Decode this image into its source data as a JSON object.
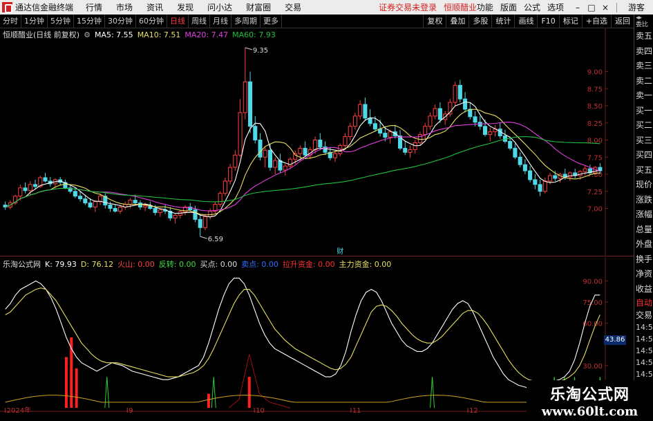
{
  "menubar": {
    "app_title": "通达信金融终端",
    "items": [
      "行情",
      "市场",
      "资讯",
      "发现",
      "问小达",
      "财富圈",
      "交易"
    ],
    "notice": "证券交易未登录",
    "stock_name": "恒顺醋业",
    "right_items": [
      "功能",
      "版面",
      "公式",
      "选项"
    ],
    "guest": "游客"
  },
  "toolbar": {
    "periods": [
      "分时",
      "1分钟",
      "5分钟",
      "15分钟",
      "30分钟",
      "60分钟",
      "日线",
      "周线",
      "月线",
      "多周期",
      "更多"
    ],
    "active_period": "日线",
    "right_buttons": [
      "复权",
      "叠加",
      "多股",
      "统计",
      "画线",
      "F10",
      "标记",
      "+自选",
      "返回"
    ]
  },
  "main_title": {
    "stock": "恒顺醋业(日线 前复权)",
    "ma5": "MA5: 7.55",
    "ma10": "MA10: 7.51",
    "ma20": "MA20: 7.47",
    "ma60": "MA60: 7.93"
  },
  "indicator_title": {
    "name": "乐淘公式网",
    "k": "K: 79.93",
    "d": "D: 76.12",
    "huoshan": "火山: 0.00",
    "fanzhuan": "反转: 0.00",
    "maidian": "买点: 0.00",
    "maichu": "卖点: 0.00",
    "lasheng": "拉升资金: 0.00",
    "zhuli": "主力资金: 0.00"
  },
  "price_axis": [
    "9.00",
    "8.75",
    "8.50",
    "8.25",
    "8.00",
    "7.75",
    "7.50",
    "7.25",
    "7.00"
  ],
  "ind_axis": [
    "90.00",
    "75.00",
    "60.00",
    "30.00",
    "15.00"
  ],
  "ind_current_value": "43.86",
  "annotations": {
    "high": "9.35",
    "low": "6.59",
    "cai": "财"
  },
  "x_axis": [
    "2024年",
    "9",
    "10",
    "11",
    "12",
    "1"
  ],
  "quote_panel": {
    "header": "委比",
    "labels": [
      "卖五",
      "卖四",
      "卖三",
      "卖二",
      "卖一",
      "买一",
      "买二",
      "买三",
      "买四",
      "买五",
      "现价",
      "涨跌",
      "涨幅",
      "总量",
      "外盘",
      "换手",
      "净资",
      "收益"
    ],
    "tab_auto": "自动",
    "tab_trade": "交易",
    "times": [
      "14:56",
      "14:56",
      "14:56",
      "14:56",
      "14:56",
      "14:56",
      "14:56",
      "14:56",
      "14:56"
    ]
  },
  "watermark": {
    "title": "乐淘公式网",
    "url": "www.60lt.com"
  },
  "colors": {
    "up": "#ff4040",
    "down": "#4ed8e8",
    "ma5": "#ffffff",
    "ma10": "#e8e060",
    "ma20": "#e040e0",
    "ma60": "#20c040",
    "k_line": "#ffffff",
    "d_line": "#e8e060"
  },
  "chart_data": [
    {
      "type": "candlestick",
      "title": "恒顺醋业(日线 前复权)",
      "ylim": [
        6.5,
        9.45
      ],
      "x_labels": [
        "2024年",
        "9",
        "10",
        "11",
        "12",
        "1"
      ],
      "x_label_index": [
        0,
        24,
        49,
        68,
        91,
        114
      ],
      "ohlc": [
        [
          7.05,
          7.1,
          6.98,
          7.02
        ],
        [
          7.02,
          7.12,
          6.99,
          7.08
        ],
        [
          7.08,
          7.2,
          7.05,
          7.18
        ],
        [
          7.18,
          7.35,
          7.12,
          7.3
        ],
        [
          7.3,
          7.38,
          7.22,
          7.26
        ],
        [
          7.26,
          7.4,
          7.2,
          7.35
        ],
        [
          7.35,
          7.42,
          7.28,
          7.32
        ],
        [
          7.32,
          7.48,
          7.3,
          7.45
        ],
        [
          7.45,
          7.52,
          7.38,
          7.4
        ],
        [
          7.4,
          7.46,
          7.32,
          7.36
        ],
        [
          7.36,
          7.44,
          7.3,
          7.42
        ],
        [
          7.42,
          7.46,
          7.34,
          7.38
        ],
        [
          7.38,
          7.42,
          7.28,
          7.3
        ],
        [
          7.3,
          7.35,
          7.22,
          7.25
        ],
        [
          7.25,
          7.3,
          7.15,
          7.18
        ],
        [
          7.18,
          7.25,
          7.1,
          7.14
        ],
        [
          7.14,
          7.2,
          7.05,
          7.08
        ],
        [
          7.08,
          7.15,
          7.0,
          7.02
        ],
        [
          7.02,
          7.12,
          6.95,
          7.1
        ],
        [
          7.1,
          7.22,
          7.05,
          7.18
        ],
        [
          7.18,
          7.22,
          7.0,
          7.05
        ],
        [
          7.05,
          7.1,
          6.95,
          7.0
        ],
        [
          7.0,
          7.06,
          6.94,
          6.96
        ],
        [
          6.96,
          7.05,
          6.92,
          7.02
        ],
        [
          7.02,
          7.1,
          6.98,
          7.06
        ],
        [
          7.06,
          7.15,
          7.0,
          7.12
        ],
        [
          7.12,
          7.2,
          7.06,
          7.08
        ],
        [
          7.08,
          7.12,
          6.98,
          7.02
        ],
        [
          7.02,
          7.08,
          6.96,
          7.04
        ],
        [
          7.04,
          7.1,
          6.98,
          7.0
        ],
        [
          7.0,
          7.05,
          6.9,
          6.94
        ],
        [
          6.94,
          7.0,
          6.88,
          6.98
        ],
        [
          6.98,
          7.05,
          6.92,
          6.96
        ],
        [
          6.96,
          7.02,
          6.82,
          6.86
        ],
        [
          6.86,
          6.92,
          6.78,
          6.9
        ],
        [
          6.9,
          6.98,
          6.85,
          6.95
        ],
        [
          6.95,
          7.05,
          6.9,
          7.02
        ],
        [
          7.02,
          7.08,
          6.96,
          6.98
        ],
        [
          6.98,
          7.04,
          6.8,
          6.84
        ],
        [
          6.84,
          6.9,
          6.59,
          6.72
        ],
        [
          6.72,
          6.92,
          6.68,
          6.88
        ],
        [
          6.88,
          7.0,
          6.84,
          6.96
        ],
        [
          6.96,
          7.1,
          6.92,
          7.06
        ],
        [
          7.06,
          7.25,
          7.02,
          7.22
        ],
        [
          7.22,
          7.45,
          7.18,
          7.4
        ],
        [
          7.4,
          7.65,
          7.35,
          7.6
        ],
        [
          7.6,
          7.85,
          7.55,
          7.78
        ],
        [
          7.78,
          8.6,
          7.75,
          8.4
        ],
        [
          8.4,
          9.35,
          8.3,
          8.85
        ],
        [
          8.85,
          9.0,
          8.1,
          8.2
        ],
        [
          8.2,
          8.35,
          7.95,
          8.0
        ],
        [
          8.0,
          8.1,
          7.7,
          7.75
        ],
        [
          7.75,
          7.9,
          7.6,
          7.85
        ],
        [
          7.85,
          7.95,
          7.55,
          7.6
        ],
        [
          7.6,
          7.75,
          7.5,
          7.7
        ],
        [
          7.7,
          7.8,
          7.52,
          7.56
        ],
        [
          7.56,
          7.65,
          7.48,
          7.62
        ],
        [
          7.62,
          7.75,
          7.58,
          7.72
        ],
        [
          7.72,
          7.85,
          7.65,
          7.8
        ],
        [
          7.8,
          7.92,
          7.7,
          7.88
        ],
        [
          7.88,
          7.98,
          7.75,
          7.78
        ],
        [
          7.78,
          7.9,
          7.72,
          7.86
        ],
        [
          7.86,
          8.05,
          7.8,
          8.0
        ],
        [
          8.0,
          8.1,
          7.85,
          7.9
        ],
        [
          7.9,
          7.98,
          7.78,
          7.82
        ],
        [
          7.82,
          7.9,
          7.7,
          7.74
        ],
        [
          7.74,
          7.85,
          7.68,
          7.8
        ],
        [
          7.8,
          7.95,
          7.76,
          7.92
        ],
        [
          7.92,
          8.1,
          7.88,
          8.05
        ],
        [
          8.05,
          8.25,
          8.0,
          8.2
        ],
        [
          8.2,
          8.4,
          8.15,
          8.35
        ],
        [
          8.35,
          8.58,
          8.3,
          8.52
        ],
        [
          8.52,
          8.62,
          8.28,
          8.32
        ],
        [
          8.32,
          8.45,
          8.2,
          8.24
        ],
        [
          8.24,
          8.35,
          8.12,
          8.16
        ],
        [
          8.16,
          8.3,
          8.05,
          8.1
        ],
        [
          8.1,
          8.2,
          7.98,
          8.04
        ],
        [
          8.04,
          8.15,
          7.95,
          8.12
        ],
        [
          8.12,
          8.22,
          8.02,
          8.06
        ],
        [
          8.06,
          8.15,
          7.85,
          7.88
        ],
        [
          7.88,
          7.98,
          7.78,
          7.82
        ],
        [
          7.82,
          7.92,
          7.74,
          7.86
        ],
        [
          7.86,
          8.0,
          7.8,
          7.96
        ],
        [
          7.96,
          8.12,
          7.92,
          8.08
        ],
        [
          8.08,
          8.25,
          8.02,
          8.2
        ],
        [
          8.2,
          8.4,
          8.15,
          8.35
        ],
        [
          8.35,
          8.52,
          8.3,
          8.46
        ],
        [
          8.46,
          8.55,
          8.25,
          8.3
        ],
        [
          8.3,
          8.42,
          8.22,
          8.38
        ],
        [
          8.38,
          8.6,
          8.34,
          8.55
        ],
        [
          8.55,
          8.85,
          8.5,
          8.8
        ],
        [
          8.8,
          8.88,
          8.55,
          8.6
        ],
        [
          8.6,
          8.7,
          8.4,
          8.45
        ],
        [
          8.45,
          8.55,
          8.3,
          8.34
        ],
        [
          8.34,
          8.42,
          8.2,
          8.26
        ],
        [
          8.26,
          8.35,
          8.15,
          8.2
        ],
        [
          8.2,
          8.3,
          8.05,
          8.08
        ],
        [
          8.08,
          8.18,
          7.98,
          8.12
        ],
        [
          8.12,
          8.22,
          8.05,
          8.16
        ],
        [
          8.16,
          8.25,
          8.02,
          8.06
        ],
        [
          8.06,
          8.15,
          7.95,
          7.98
        ],
        [
          7.98,
          8.05,
          7.85,
          7.88
        ],
        [
          7.88,
          7.95,
          7.72,
          7.75
        ],
        [
          7.75,
          7.82,
          7.6,
          7.64
        ],
        [
          7.64,
          7.72,
          7.5,
          7.55
        ],
        [
          7.55,
          7.62,
          7.38,
          7.42
        ],
        [
          7.42,
          7.5,
          7.28,
          7.35
        ],
        [
          7.35,
          7.42,
          7.18,
          7.25
        ],
        [
          7.25,
          7.45,
          7.22,
          7.4
        ],
        [
          7.4,
          7.52,
          7.35,
          7.48
        ],
        [
          7.48,
          7.55,
          7.4,
          7.44
        ],
        [
          7.44,
          7.52,
          7.38,
          7.5
        ],
        [
          7.5,
          7.58,
          7.42,
          7.46
        ],
        [
          7.46,
          7.54,
          7.4,
          7.52
        ],
        [
          7.52,
          7.58,
          7.44,
          7.48
        ],
        [
          7.48,
          7.56,
          7.42,
          7.54
        ],
        [
          7.54,
          7.62,
          7.48,
          7.58
        ],
        [
          7.58,
          7.64,
          7.5,
          7.52
        ],
        [
          7.52,
          7.62,
          7.48,
          7.6
        ],
        [
          7.6,
          7.66,
          7.5,
          7.55
        ]
      ]
    },
    {
      "type": "line",
      "title": "乐淘公式网",
      "ylim": [
        0,
        100
      ],
      "series": [
        {
          "name": "K",
          "values": [
            70,
            74,
            80,
            84,
            86,
            88,
            90,
            88,
            84,
            78,
            70,
            60,
            50,
            42,
            36,
            32,
            30,
            28,
            26,
            28,
            30,
            32,
            31,
            30,
            28,
            26,
            25,
            24,
            23,
            22,
            21,
            20,
            20,
            21,
            22,
            24,
            26,
            28,
            30,
            36,
            46,
            58,
            70,
            80,
            88,
            92,
            92,
            88,
            80,
            70,
            60,
            52,
            46,
            42,
            40,
            38,
            36,
            34,
            32,
            30,
            28,
            26,
            24,
            22,
            22,
            24,
            30,
            40,
            54,
            66,
            76,
            82,
            84,
            82,
            76,
            68,
            60,
            54,
            48,
            44,
            42,
            40,
            40,
            42,
            46,
            52,
            58,
            64,
            70,
            74,
            76,
            74,
            68,
            60,
            52,
            44,
            36,
            30,
            24,
            20,
            18,
            16,
            15,
            14,
            15,
            16,
            17,
            18,
            19,
            20,
            22,
            26,
            34,
            46,
            60,
            72,
            80,
            80
          ]
        },
        {
          "name": "D",
          "values": [
            66,
            68,
            72,
            76,
            80,
            82,
            84,
            85,
            84,
            80,
            76,
            70,
            64,
            58,
            52,
            46,
            42,
            38,
            35,
            33,
            32,
            32,
            32,
            31,
            30,
            29,
            28,
            27,
            26,
            25,
            24,
            23,
            22,
            22,
            22,
            23,
            24,
            25,
            27,
            30,
            35,
            42,
            50,
            58,
            66,
            74,
            80,
            84,
            84,
            80,
            74,
            68,
            62,
            56,
            52,
            48,
            45,
            42,
            40,
            38,
            36,
            34,
            32,
            30,
            28,
            27,
            28,
            31,
            36,
            44,
            52,
            60,
            68,
            72,
            73,
            72,
            69,
            65,
            60,
            56,
            52,
            49,
            47,
            46,
            46,
            48,
            51,
            55,
            59,
            63,
            67,
            69,
            69,
            67,
            63,
            58,
            52,
            46,
            40,
            34,
            29,
            25,
            22,
            20,
            19,
            18,
            18,
            18,
            18,
            19,
            20,
            22,
            25,
            30,
            38,
            48,
            58,
            66
          ]
        }
      ]
    }
  ]
}
